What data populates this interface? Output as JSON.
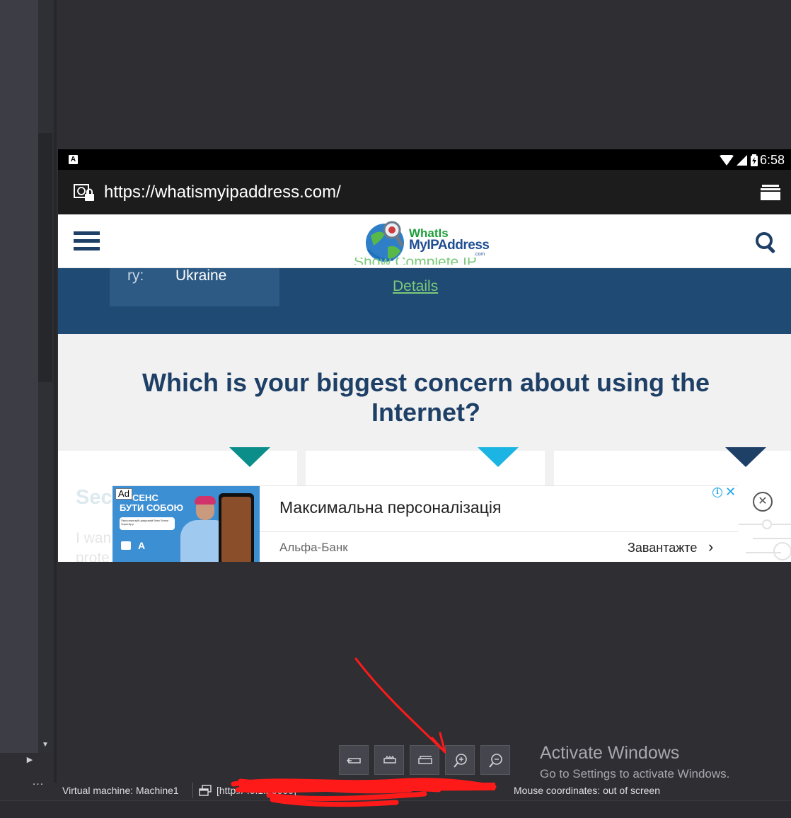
{
  "device": {
    "status_time": "6:58",
    "status_a": "A",
    "url": "https://whatismyipaddress.com/"
  },
  "site": {
    "logo_line1": "WhatIs",
    "logo_line2": "MyIPAddress",
    "logo_suffix": ".com",
    "country_label": "ry:",
    "country_value": "Ukraine",
    "partial_link_text": "Show Complete IP",
    "details_link": "Details",
    "question": "Which is your biggest concern about using the Internet?",
    "behind_heading": "Sec",
    "behind_line1": "I wan",
    "behind_line2": "prote"
  },
  "ad": {
    "badge": "Ad",
    "image_text_line1": "СЕНС",
    "image_text_line2": "БУТИ СОБОЮ",
    "image_small_text": "Персоналізуй цифровий банк Sense SuperApp",
    "image_logo_letter": "A",
    "title": "Максимальна персоналізація",
    "advertiser": "Альфа-Банк",
    "cta": "Завантажте",
    "cta_chevron": "›",
    "info_icon": "i",
    "x_icon": "✕",
    "close_icon": "✕"
  },
  "toolbar": {
    "buttons": [
      {
        "name": "rotate-left",
        "icon": "rotate-left-icon"
      },
      {
        "name": "rotate-right",
        "icon": "rotate-right-icon"
      },
      {
        "name": "screenshot",
        "icon": "screenshot-icon"
      },
      {
        "name": "zoom-in",
        "icon": "zoom-in-icon"
      },
      {
        "name": "zoom-out",
        "icon": "zoom-out-icon"
      }
    ]
  },
  "watermark": {
    "title": "Activate Windows",
    "subtitle": "Go to Settings to activate Windows."
  },
  "statusbar": {
    "vm_label": "Virtual machine: Machine1",
    "url_status": "[http://                                    :0.1:20000]",
    "mouse_coords": "Mouse coordinates: out of screen"
  },
  "ide": {
    "scroll_down": "▼",
    "expand": "▶",
    "more": "..."
  },
  "colors": {
    "site_blue": "#1e4a73",
    "question_text": "#1e3f66",
    "link_green": "#7dc97a",
    "teal": "#0b8d8a",
    "cyan": "#1cb5e3",
    "navy": "#1e3f66",
    "annotation_red": "#ff1a1a"
  }
}
